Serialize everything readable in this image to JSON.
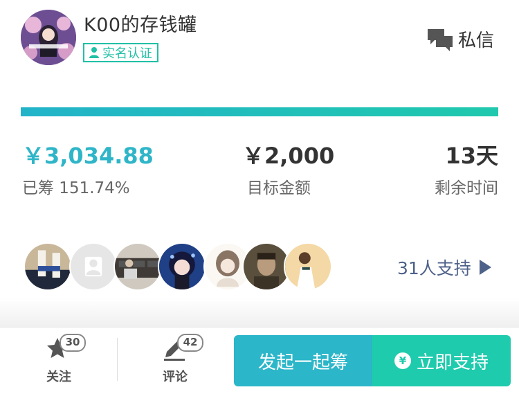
{
  "header": {
    "username": "K00的存钱罐",
    "verified_label": "实名认证",
    "message_label": "私信"
  },
  "progress": {
    "fraction": 1.0,
    "color_start": "#22b3c9",
    "color_end": "#20c9ad"
  },
  "stats": {
    "raised_value": "￥3,034.88",
    "raised_label": "已筹 151.74%",
    "target_value": "￥2,000",
    "target_label": "目标金额",
    "days_value": "13天",
    "days_label": "剩余时间"
  },
  "supporters": {
    "link_label": "31人支持",
    "avatars": [
      "supporter-avatar",
      "default-avatar",
      "supporter-avatar",
      "supporter-avatar",
      "supporter-avatar",
      "supporter-avatar",
      "supporter-avatar"
    ]
  },
  "bottom_bar": {
    "follow_label": "关注",
    "follow_count": "30",
    "comment_label": "评论",
    "comment_count": "42",
    "start_button": "发起一起筹",
    "support_button": "立即支持",
    "support_icon_glyph": "¥"
  },
  "colors": {
    "accent": "#2fb5c8",
    "green": "#20c0a6",
    "link": "#4e6189"
  }
}
